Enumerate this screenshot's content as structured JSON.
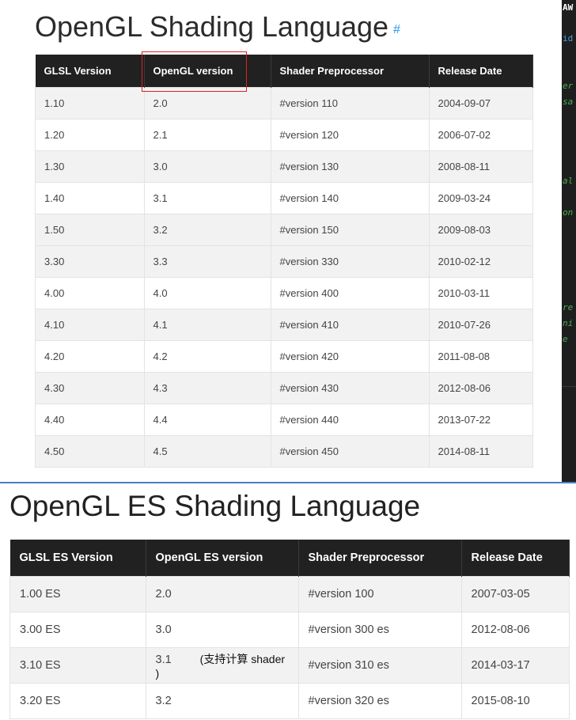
{
  "glsl": {
    "title": "OpenGL Shading Language",
    "anchor": "#",
    "headers": [
      "GLSL Version",
      "OpenGL version",
      "Shader Preprocessor",
      "Release Date"
    ],
    "rows": [
      [
        "1.10",
        "2.0",
        "#version 110",
        "2004-09-07"
      ],
      [
        "1.20",
        "2.1",
        "#version 120",
        "2006-07-02"
      ],
      [
        "1.30",
        "3.0",
        "#version 130",
        "2008-08-11"
      ],
      [
        "1.40",
        "3.1",
        "#version 140",
        "2009-03-24"
      ],
      [
        "1.50",
        "3.2",
        "#version 150",
        "2009-08-03"
      ],
      [
        "3.30",
        "3.3",
        "#version 330",
        "2010-02-12"
      ],
      [
        "4.00",
        "4.0",
        "#version 400",
        "2010-03-11"
      ],
      [
        "4.10",
        "4.1",
        "#version 410",
        "2010-07-26"
      ],
      [
        "4.20",
        "4.2",
        "#version 420",
        "2011-08-08"
      ],
      [
        "4.30",
        "4.3",
        "#version 430",
        "2012-08-06"
      ],
      [
        "4.40",
        "4.4",
        "#version 440",
        "2013-07-22"
      ],
      [
        "4.50",
        "4.5",
        "#version 450",
        "2014-08-11"
      ]
    ]
  },
  "editor": {
    "lines": [
      "AW",
      "id",
      "er",
      "sa",
      "al",
      "on",
      "re",
      "ni",
      "e"
    ]
  },
  "gles": {
    "title": "OpenGL ES Shading Language",
    "headers": [
      "GLSL ES Version",
      "OpenGL ES version",
      "Shader Preprocessor",
      "Release Date"
    ],
    "rows": [
      [
        "1.00 ES",
        "2.0",
        "#version 100",
        "2007-03-05"
      ],
      [
        "3.00 ES",
        "3.0",
        "#version 300 es",
        "2012-08-06"
      ],
      [
        "3.10 ES",
        "3.1",
        "#version 310 es",
        "2014-03-17"
      ],
      [
        "3.20 ES",
        "3.2",
        "#version 320 es",
        "2015-08-10"
      ]
    ],
    "note": "(支持计算 shader )"
  },
  "colors": {
    "header_bg": "#212121",
    "highlight": "#e02020",
    "anchor": "#2196f3",
    "divider": "#4a7fc1"
  }
}
